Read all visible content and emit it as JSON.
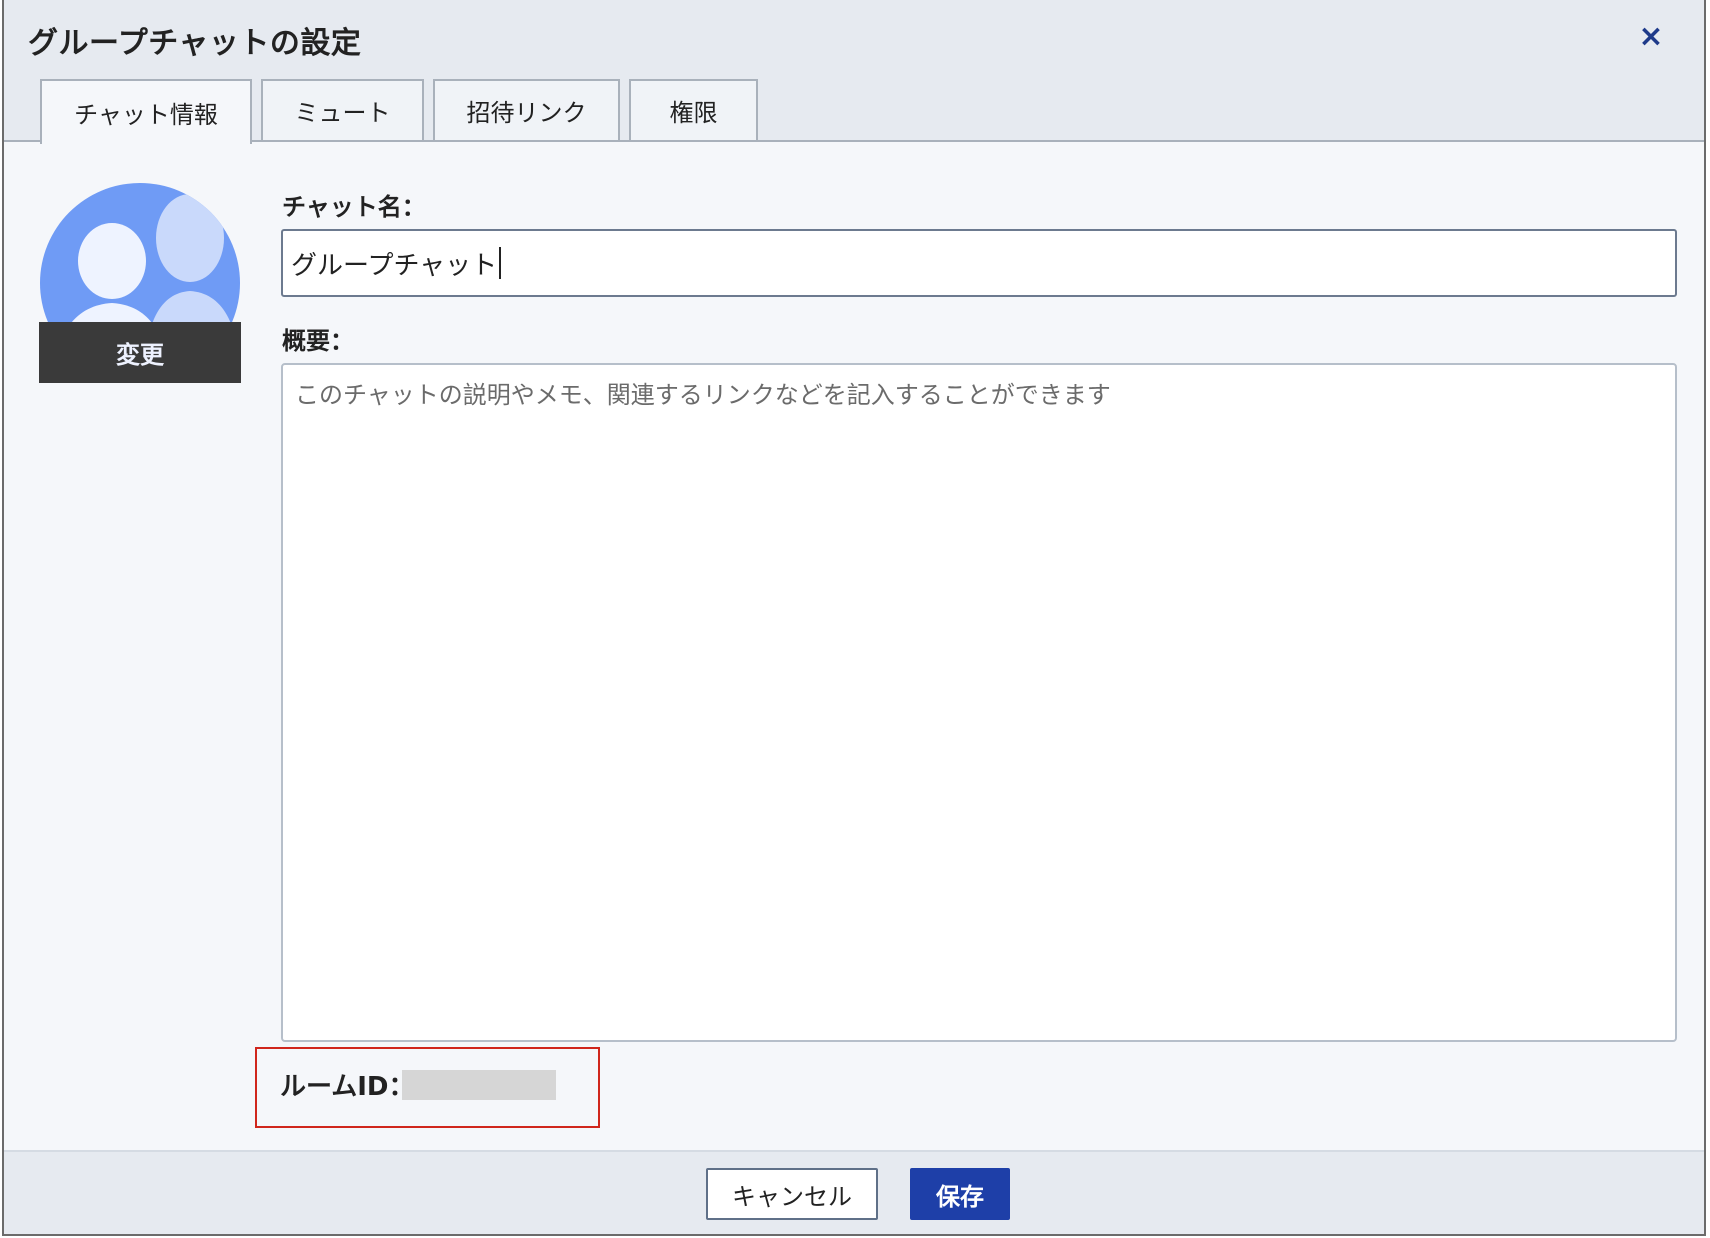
{
  "dialog": {
    "title": "グループチャットの設定",
    "close_label": "×"
  },
  "tabs": [
    {
      "label": "チャット情報",
      "active": true
    },
    {
      "label": "ミュート",
      "active": false
    },
    {
      "label": "招待リンク",
      "active": false
    },
    {
      "label": "権限",
      "active": false
    }
  ],
  "avatar": {
    "icon": "group-avatar-icon",
    "change_label": "変更"
  },
  "form": {
    "name_label": "チャット名：",
    "name_value": "グループチャット",
    "description_label": "概要：",
    "description_placeholder": "このチャットの説明やメモ、関連するリンクなどを記入することができます",
    "room_id_label": "ルームID："
  },
  "footer": {
    "cancel_label": "キャンセル",
    "save_label": "保存"
  },
  "colors": {
    "accent": "#1e3fa8",
    "avatar_bg": "#6f9bf5",
    "highlight_border": "#d0261c"
  }
}
